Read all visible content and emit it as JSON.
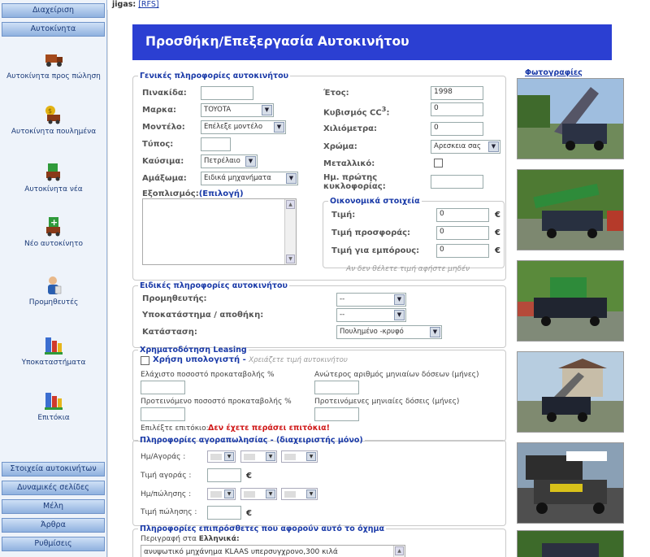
{
  "topbar": {
    "user": "jigas:",
    "link": "[RFS]"
  },
  "sidebar": {
    "top_buttons": [
      "Διαχείριση",
      "Αυτοκίνητα"
    ],
    "items": [
      {
        "label": "Αυτοκίνητα προς πώληση",
        "icon": "truck-icon"
      },
      {
        "label": "Αυτοκίνητα πουλημένα",
        "icon": "sold-car-icon"
      },
      {
        "label": "Αυτοκίνητα νέα",
        "icon": "new-car-icon"
      },
      {
        "label": "Νέο αυτοκίνητο",
        "icon": "add-car-icon"
      },
      {
        "label": "Προμηθευτές",
        "icon": "supplier-icon"
      },
      {
        "label": "Υποκαταστήματα",
        "icon": "branches-icon"
      },
      {
        "label": "Επιτόκια",
        "icon": "interest-icon"
      }
    ],
    "bottom_buttons": [
      "Στοιχεία αυτοκινήτων",
      "Δυναμικές σελίδες",
      "Μέλη",
      "Άρθρα",
      "Ρυθμίσεις"
    ]
  },
  "page": {
    "title": "Προσθήκη/Επεξεργασία Αυτοκινήτου"
  },
  "general": {
    "legend": "Γενικές πληροφορίες αυτοκινήτου",
    "plate_label": "Πινακίδα:",
    "make_label": "Μαρκα:",
    "make_value": "TOYOTA",
    "model_label": "Μοντέλο:",
    "model_value": "Επέλεξε μοντέλο",
    "type_label": "Τύπος:",
    "fuel_label": "Καύσιμα:",
    "fuel_value": "Πετρέλαιο",
    "body_label": "Αμάξωμα:",
    "body_value": "Ειδικά μηχανήματα",
    "equipment_label": "Εξοπλισμός:",
    "equipment_link": "(Επιλογή)",
    "year_label": "Έτος:",
    "year_value": "1998",
    "cc_label": "Κυβισμός CC",
    "cc_sup": "3",
    "cc_colon": ":",
    "cc_value": "0",
    "km_label": "Χιλιόμετρα:",
    "km_value": "0",
    "color_label": "Χρώμα:",
    "color_value": "Αρεσκεια σας",
    "metallic_label": "Μεταλλικό:",
    "first_reg_label_1": "Ημ. πρώτης",
    "first_reg_label_2": "κυκλοφορίας:"
  },
  "finance": {
    "legend": "Οικονομικά στοιχεία",
    "price_label": "Τιμή:",
    "price_value": "0",
    "offer_label": "Τιμή προσφοράς:",
    "offer_value": "0",
    "dealer_label": "Τιμή για εμπόρους:",
    "dealer_value": "0",
    "currency": "€",
    "hint": "Αν δεν θέλετε τιμή αφήστε μηδέν"
  },
  "special": {
    "legend": "Ειδικές πληροφορίες αυτοκινήτου",
    "supplier_label": "Προμηθευτής:",
    "supplier_value": "--",
    "branch_label": "Υποκατάστημα / αποθήκη:",
    "branch_value": "--",
    "status_label": "Κατάσταση:",
    "status_value": "Πουλημένο -κρυφό"
  },
  "leasing": {
    "legend": "Χρηματοδότηση Leasing",
    "calc_label": "Χρήση υπολογιστή",
    "calc_dash": " - ",
    "calc_hint": "Χρειάζετε τιμή αυτοκινήτου",
    "min_down_label": "Ελάχιστο ποσοστό προκαταβολής %",
    "max_months_label": "Ανώτερος αριθμός μηνιαίων δόσεων (μήνες)",
    "sugg_down_label": "Προτεινόμενο ποσοστό προκαταβολής %",
    "sugg_months_label": "Προτεινόμενες μηνιαίες δόσεις (μήνες)",
    "rate_label": "Επιλέξτε επιτόκιο:",
    "rate_warning": "Δεν έχετε περάσει επιτόκια!"
  },
  "trade": {
    "legend": "Πληροφορίες αγοραπωλησίας - (διαχειριστής μόνο)",
    "buy_date_label": "Ημ/Αγοράς :",
    "buy_price_label": "Τιμή αγοράς :",
    "sell_date_label": "Ημ/πώλησης :",
    "sell_price_label": "Τιμή πώλησης :",
    "currency": "€"
  },
  "extra": {
    "legend": "Πληροφορίες επιπρόσθετες που αφορούν αυτό το όχημα",
    "desc_label": "Περιγραφή στα",
    "desc_lang": "Ελληνικά",
    "desc_colon": ":",
    "desc_value": "ανυψωτικό μηχάνημα KLAAS υπερσυγχρονο,300 κιλά"
  },
  "photos": {
    "legend": "Φωτογραφίες"
  }
}
